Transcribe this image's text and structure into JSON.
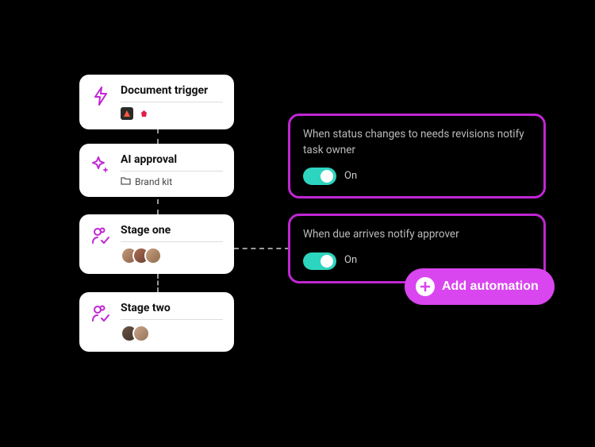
{
  "stages": [
    {
      "title": "Document trigger"
    },
    {
      "title": "AI approval",
      "meta_label": "Brand kit"
    },
    {
      "title": "Stage one"
    },
    {
      "title": "Stage two"
    }
  ],
  "automations": [
    {
      "desc": "When status changes to needs revisions notify task owner",
      "toggle_label": "On"
    },
    {
      "desc": "When due arrives notify approver",
      "toggle_label": "On"
    }
  ],
  "add_button_label": "Add automation",
  "colors": {
    "accent": "#c026d3",
    "toggle_on": "#2dd4bf"
  },
  "avatar_colors": {
    "stage_one": [
      "#c79a7a",
      "#ae6d55",
      "#c7a27f"
    ],
    "stage_two": [
      "#6b5649",
      "#c9a58b"
    ]
  },
  "app_badges": {
    "badge1_bg": "#2a2a2a",
    "badge2_bg": "#fff"
  }
}
